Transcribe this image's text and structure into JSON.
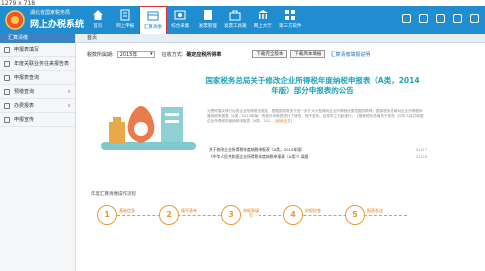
{
  "window": {
    "resolution_label": "1279 x 718"
  },
  "header": {
    "org_line": "湖北省国家税务局",
    "app_title": "网上办税系统",
    "nav": [
      {
        "label": "首页",
        "icon": "home-icon"
      },
      {
        "label": "网上申报",
        "icon": "declare-icon"
      },
      {
        "label": "汇算清缴",
        "icon": "settlement-icon"
      },
      {
        "label": "综合采集",
        "icon": "collect-icon"
      },
      {
        "label": "发票管理",
        "icon": "invoice-icon"
      },
      {
        "label": "发票工具箱",
        "icon": "toolbox-icon"
      },
      {
        "label": "网上大厅",
        "icon": "hall-icon"
      },
      {
        "label": "第三方软件",
        "icon": "thirdparty-icon"
      }
    ]
  },
  "sidebar": {
    "header": "汇算清缴",
    "items": [
      {
        "label": "申报表填写",
        "has_arrow": false
      },
      {
        "label": "年度关联业务往来报告表",
        "has_arrow": false
      },
      {
        "label": "申报表查询",
        "has_arrow": false
      },
      {
        "label": "预缴查询",
        "has_arrow": true
      },
      {
        "label": "办费报表",
        "has_arrow": true
      },
      {
        "label": "申报宣传",
        "has_arrow": false
      }
    ]
  },
  "main": {
    "breadcrumb": "首页",
    "filter": {
      "year_label": "税款所属期:",
      "year_value": "2015年",
      "method_label": "征收方式:",
      "method_value": "确定应税所得率",
      "download_full": "下载完全版本",
      "download_simple": "下载简本填报",
      "help_link": "汇算清缴填报说明"
    },
    "banner": {
      "title": "国家税务总局关于修改企业所得税年度纳税申报表（A类，2014年版）部分申报表的公告",
      "body": "为贯彻落实修订后的企业所得税法规定，根据国务院关于进一步扩大小型微利企业所得税优惠范围的精神，国家税务总局对企业所得税年度纳税申报表（A类，2014年版）的部分申报表进行了修改，现予发布。自发布之日起施行。《国家税务总局关于发布〈中华人民共和国企业所得税年度纳税申报表（A类，201...",
      "more": "[阅读全文]",
      "links": [
        {
          "text": "关于修改企业所得税年度纳税申报表（A类，2014年版）",
          "date": "01/27"
        },
        {
          "text": "《中华人民共和国企业所得税年度纳税申报表（A类）》填报",
          "date": "01/26"
        }
      ]
    },
    "flow": {
      "title": "年度汇算清缴操作流程",
      "steps": [
        {
          "num": "1",
          "label": "基础信息"
        },
        {
          "num": "2",
          "label": "填写表单"
        },
        {
          "num": "3",
          "label": "申报表填写"
        },
        {
          "num": "4",
          "label": "申报检查"
        },
        {
          "num": "5",
          "label": "报表发送"
        }
      ]
    }
  }
}
